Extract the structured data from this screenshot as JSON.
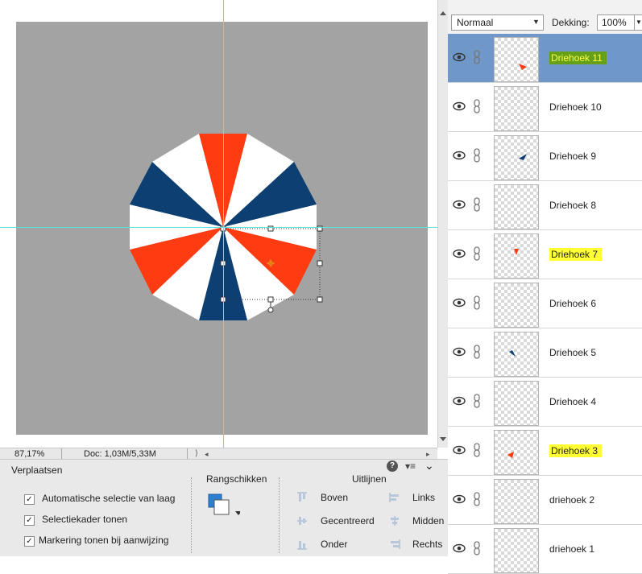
{
  "blend_mode": {
    "value": "Normaal"
  },
  "opacity": {
    "label": "Dekking:",
    "value": "100%"
  },
  "layers": [
    {
      "name": "Driehoek 11",
      "selected": true,
      "highlight": "green"
    },
    {
      "name": "Driehoek 10"
    },
    {
      "name": "Driehoek 9"
    },
    {
      "name": "Driehoek 8"
    },
    {
      "name": "Driehoek 7",
      "highlight": "yellow"
    },
    {
      "name": "Driehoek 6"
    },
    {
      "name": "Driehoek 5"
    },
    {
      "name": "Driehoek 4"
    },
    {
      "name": "Driehoek 3",
      "highlight": "yellow"
    },
    {
      "name": "driehoek 2"
    },
    {
      "name": "driehoek 1"
    }
  ],
  "status": {
    "zoom": "87,17%",
    "doc": "Doc: 1,03M/5,33M"
  },
  "tool_options": {
    "title": "Verplaatsen",
    "checkboxes": [
      {
        "label": "Automatische selectie van laag",
        "checked": true
      },
      {
        "label": "Selectiekader tonen",
        "checked": true
      },
      {
        "label": "Markering tonen bij aanwijzing",
        "checked": true
      }
    ],
    "arrange_title": "Rangschikken",
    "align_title": "Uitlijnen",
    "align": {
      "top": "Boven",
      "center": "Gecentreerd",
      "bottom": "Onder",
      "left": "Links",
      "middle": "Midden",
      "right": "Rechts"
    }
  },
  "colors": {
    "red": "#ff3b12",
    "navy": "#0d3f72",
    "white": "#ffffff",
    "selected_row": "#6f98c9",
    "canvas": "#a3a3a3",
    "guide": "#5fe0e0"
  }
}
